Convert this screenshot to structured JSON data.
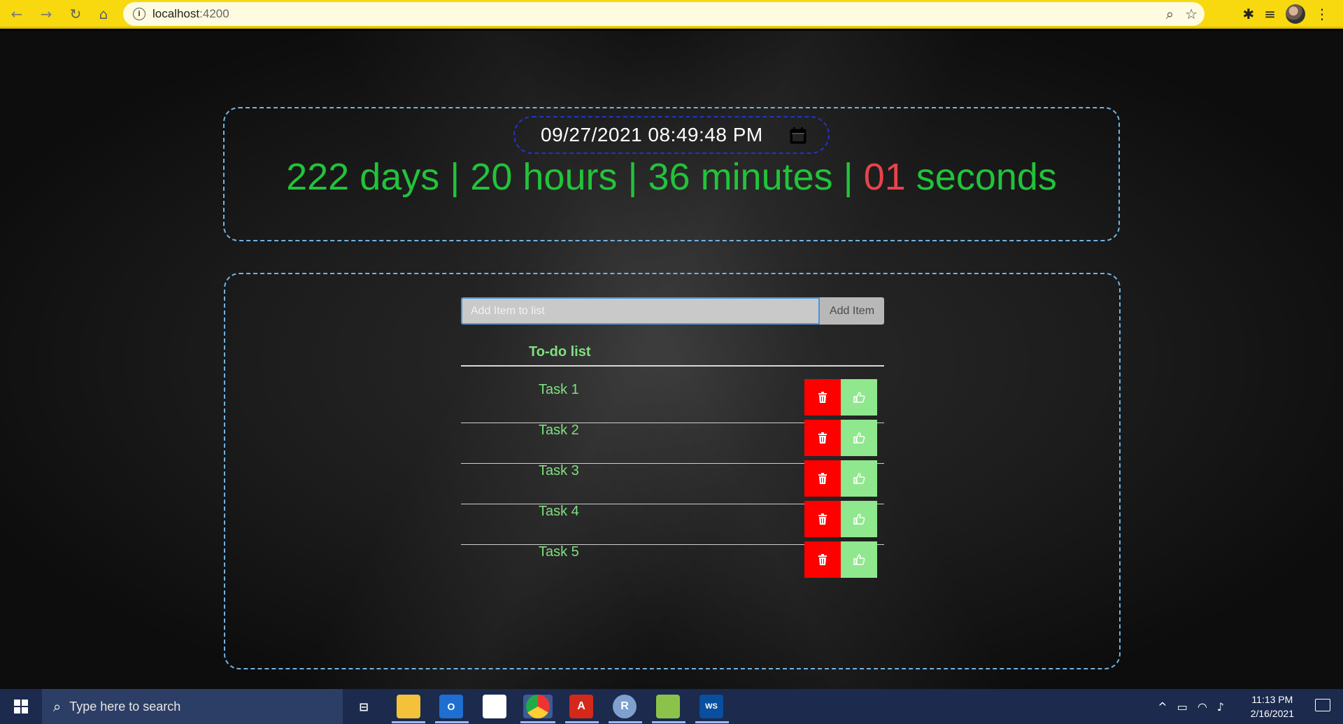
{
  "browser": {
    "url_host": "localhost",
    "url_port": ":4200"
  },
  "countdown": {
    "datetime": "09/27/2021 08:49:48 PM",
    "days": "222",
    "days_label": " days | ",
    "hours": "20",
    "hours_label": " hours | ",
    "minutes": "36",
    "minutes_label": " minutes | ",
    "seconds": "01",
    "seconds_label": " seconds"
  },
  "todo": {
    "input_placeholder": "Add Item to list",
    "add_button_label": "Add Item",
    "list_title": "To-do list",
    "tasks": [
      {
        "label": "Task 1"
      },
      {
        "label": "Task 2"
      },
      {
        "label": "Task 3"
      },
      {
        "label": "Task 4"
      },
      {
        "label": "Task 5"
      }
    ]
  },
  "taskbar": {
    "search_placeholder": "Type here to search",
    "time": "11:13 PM",
    "date": "2/16/2021"
  },
  "colors": {
    "accent_green": "#22c33a",
    "seconds_red": "#e8434b",
    "delete_red": "#ff0000",
    "like_green": "#8fe88d",
    "browser_yellow": "#f8d90f"
  }
}
